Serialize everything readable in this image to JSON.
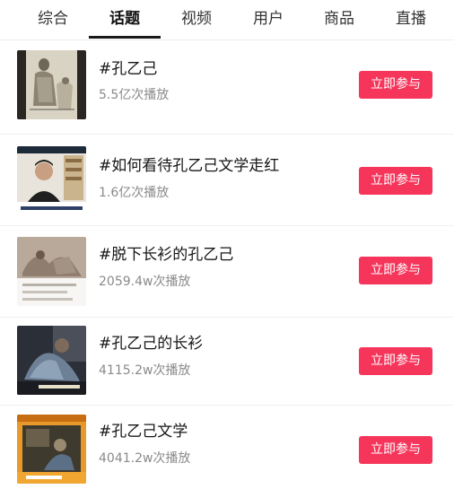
{
  "tabs": [
    {
      "label": "综合",
      "active": false
    },
    {
      "label": "话题",
      "active": true
    },
    {
      "label": "视频",
      "active": false
    },
    {
      "label": "用户",
      "active": false
    },
    {
      "label": "商品",
      "active": false
    },
    {
      "label": "直播",
      "active": false
    }
  ],
  "topics": [
    {
      "title": "#孔乙己",
      "plays": "5.5亿次播放",
      "button": "立即参与",
      "thumbnail": "sketch-illustration"
    },
    {
      "title": "#如何看待孔乙己文学走红",
      "plays": "1.6亿次播放",
      "button": "立即参与",
      "thumbnail": "presenter-video"
    },
    {
      "title": "#脱下长衫的孔乙己",
      "plays": "2059.4w次播放",
      "button": "立即参与",
      "thumbnail": "painting-with-caption"
    },
    {
      "title": "#孔乙己的长衫",
      "plays": "4115.2w次播放",
      "button": "立即参与",
      "thumbnail": "dark-video-still"
    },
    {
      "title": "#孔乙己文学",
      "plays": "4041.2w次播放",
      "button": "立即参与",
      "thumbnail": "orange-video-still"
    }
  ],
  "colors": {
    "button_bg": "#f6355b",
    "button_text": "#ffffff",
    "tab_indicator": "#1a1a1a"
  }
}
